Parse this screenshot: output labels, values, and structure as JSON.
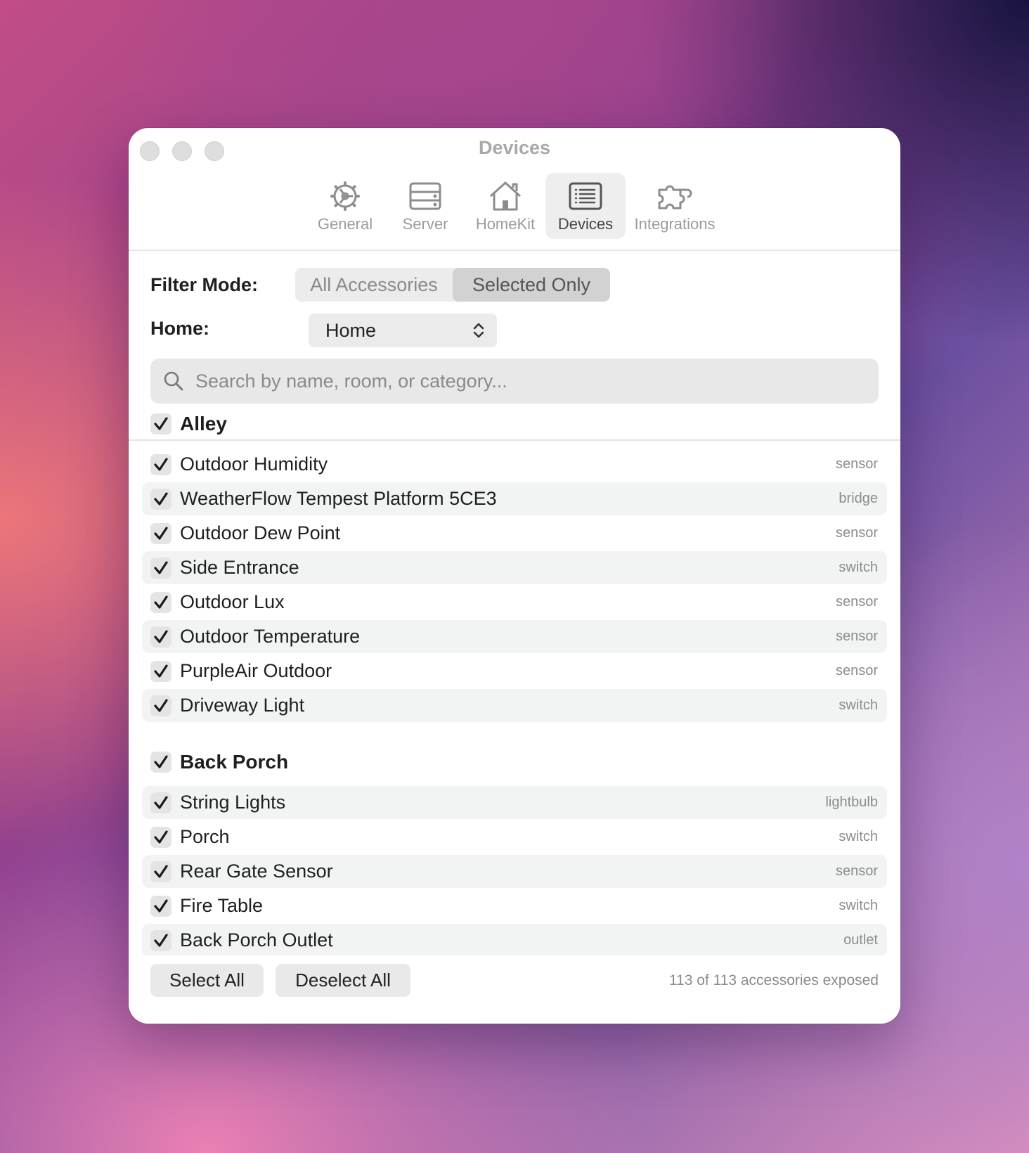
{
  "window": {
    "title": "Devices"
  },
  "toolbar": [
    {
      "label": "General",
      "icon": "gear-icon"
    },
    {
      "label": "Server",
      "icon": "server-icon"
    },
    {
      "label": "HomeKit",
      "icon": "house-icon"
    },
    {
      "label": "Devices",
      "icon": "list-icon",
      "active": true
    },
    {
      "label": "Integrations",
      "icon": "puzzle-icon"
    }
  ],
  "filter": {
    "label": "Filter Mode:",
    "options": [
      "All Accessories",
      "Selected Only"
    ],
    "selected": "Selected Only"
  },
  "home": {
    "label": "Home:",
    "value": "Home"
  },
  "search": {
    "placeholder": "Search by name, room, or category..."
  },
  "sections": [
    {
      "name": "Alley",
      "checked": true,
      "items": [
        {
          "name": "Outdoor Humidity",
          "category": "sensor",
          "checked": true
        },
        {
          "name": "WeatherFlow Tempest Platform 5CE3",
          "category": "bridge",
          "checked": true
        },
        {
          "name": "Outdoor Dew Point",
          "category": "sensor",
          "checked": true
        },
        {
          "name": "Side Entrance",
          "category": "switch",
          "checked": true
        },
        {
          "name": "Outdoor Lux",
          "category": "sensor",
          "checked": true
        },
        {
          "name": "Outdoor Temperature",
          "category": "sensor",
          "checked": true
        },
        {
          "name": "PurpleAir Outdoor",
          "category": "sensor",
          "checked": true
        },
        {
          "name": "Driveway Light",
          "category": "switch",
          "checked": true
        }
      ]
    },
    {
      "name": "Back Porch",
      "checked": true,
      "items": [
        {
          "name": "String Lights",
          "category": "lightbulb",
          "checked": true
        },
        {
          "name": "Porch",
          "category": "switch",
          "checked": true
        },
        {
          "name": "Rear Gate Sensor",
          "category": "sensor",
          "checked": true
        },
        {
          "name": "Fire Table",
          "category": "switch",
          "checked": true
        },
        {
          "name": "Back Porch Outlet",
          "category": "outlet",
          "checked": true
        }
      ]
    }
  ],
  "footer": {
    "select_all": "Select All",
    "deselect_all": "Deselect All",
    "status": "113 of 113 accessories exposed"
  },
  "colors": {
    "window_bg": "#ffffff",
    "row_alt": "#f2f3f3",
    "segment_on": "#d2d2d2"
  }
}
